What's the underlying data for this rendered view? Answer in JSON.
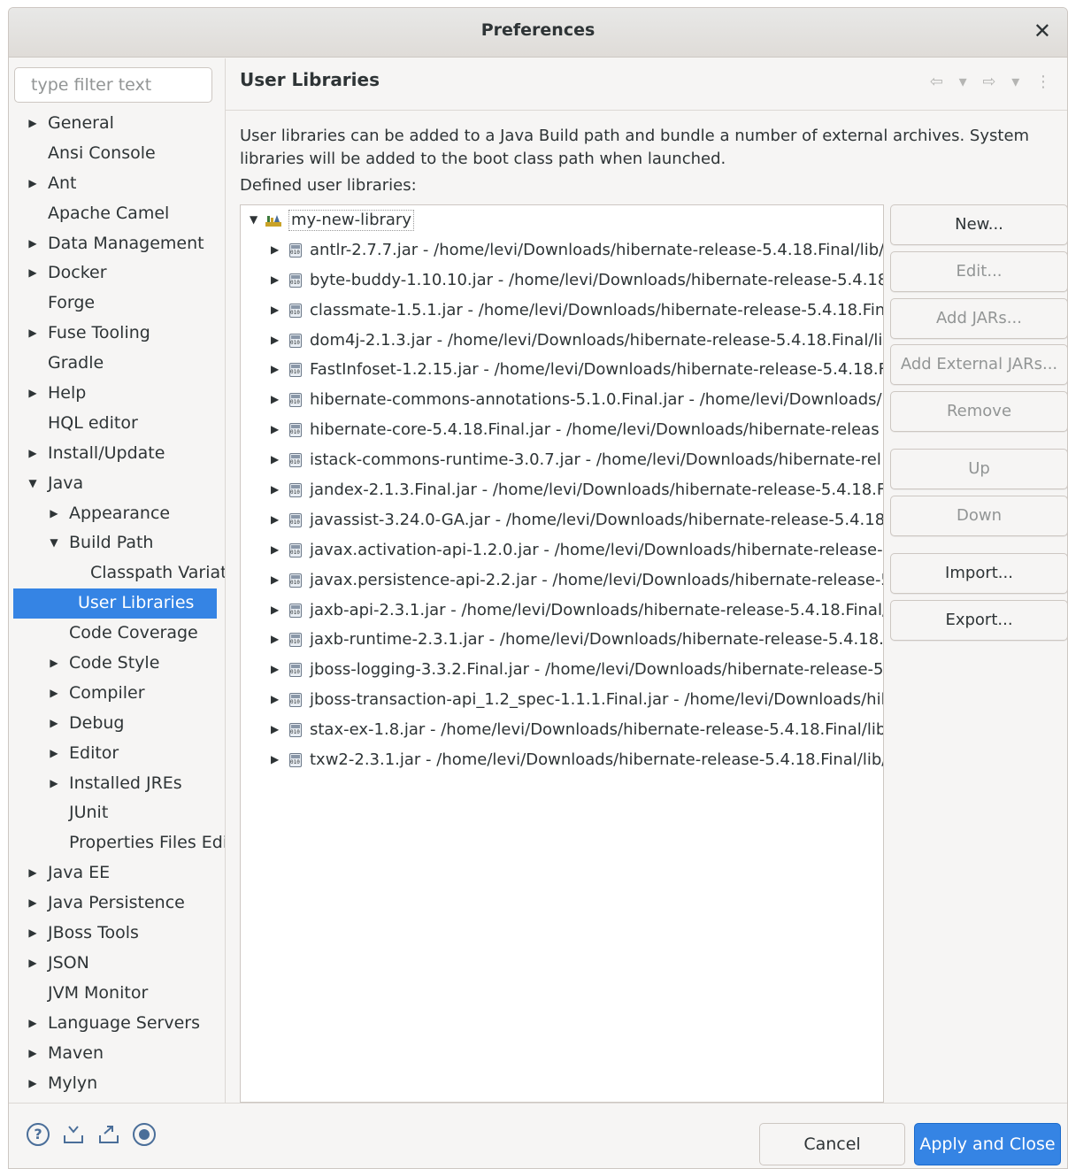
{
  "window": {
    "title": "Preferences",
    "close_glyph": "✕"
  },
  "filter": {
    "placeholder": "type filter text"
  },
  "tree": [
    {
      "label": "General",
      "level": 0,
      "expander": "closed"
    },
    {
      "label": "Ansi Console",
      "level": 0,
      "expander": "none"
    },
    {
      "label": "Ant",
      "level": 0,
      "expander": "closed"
    },
    {
      "label": "Apache Camel",
      "level": 0,
      "expander": "none"
    },
    {
      "label": "Data Management",
      "level": 0,
      "expander": "closed"
    },
    {
      "label": "Docker",
      "level": 0,
      "expander": "closed"
    },
    {
      "label": "Forge",
      "level": 0,
      "expander": "none"
    },
    {
      "label": "Fuse Tooling",
      "level": 0,
      "expander": "closed"
    },
    {
      "label": "Gradle",
      "level": 0,
      "expander": "none"
    },
    {
      "label": "Help",
      "level": 0,
      "expander": "closed"
    },
    {
      "label": "HQL editor",
      "level": 0,
      "expander": "none"
    },
    {
      "label": "Install/Update",
      "level": 0,
      "expander": "closed"
    },
    {
      "label": "Java",
      "level": 0,
      "expander": "open"
    },
    {
      "label": "Appearance",
      "level": 1,
      "expander": "closed"
    },
    {
      "label": "Build Path",
      "level": 1,
      "expander": "open"
    },
    {
      "label": "Classpath Variat",
      "level": 2,
      "expander": "none"
    },
    {
      "label": "User Libraries",
      "level": 2,
      "expander": "none",
      "selected": true
    },
    {
      "label": "Code Coverage",
      "level": 1,
      "expander": "none"
    },
    {
      "label": "Code Style",
      "level": 1,
      "expander": "closed"
    },
    {
      "label": "Compiler",
      "level": 1,
      "expander": "closed"
    },
    {
      "label": "Debug",
      "level": 1,
      "expander": "closed"
    },
    {
      "label": "Editor",
      "level": 1,
      "expander": "closed"
    },
    {
      "label": "Installed JREs",
      "level": 1,
      "expander": "closed"
    },
    {
      "label": "JUnit",
      "level": 1,
      "expander": "none"
    },
    {
      "label": "Properties Files Edi",
      "level": 1,
      "expander": "none"
    },
    {
      "label": "Java EE",
      "level": 0,
      "expander": "closed"
    },
    {
      "label": "Java Persistence",
      "level": 0,
      "expander": "closed"
    },
    {
      "label": "JBoss Tools",
      "level": 0,
      "expander": "closed"
    },
    {
      "label": "JSON",
      "level": 0,
      "expander": "closed"
    },
    {
      "label": "JVM Monitor",
      "level": 0,
      "expander": "none"
    },
    {
      "label": "Language Servers",
      "level": 0,
      "expander": "closed"
    },
    {
      "label": "Maven",
      "level": 0,
      "expander": "closed"
    },
    {
      "label": "Mylyn",
      "level": 0,
      "expander": "closed"
    }
  ],
  "page": {
    "title": "User Libraries",
    "nav_icons": "⇦ ▾ ⇨ ▾ ⋮",
    "description": "User libraries can be added to a Java Build path and bundle a number of external archives. System libraries will be added to the boot class path when launched.",
    "defined_label": "Defined user libraries:",
    "library": "my-new-library",
    "jars": [
      "antlr-2.7.7.jar - /home/levi/Downloads/hibernate-release-5.4.18.Final/lib/",
      "byte-buddy-1.10.10.jar - /home/levi/Downloads/hibernate-release-5.4.18.",
      "classmate-1.5.1.jar - /home/levi/Downloads/hibernate-release-5.4.18.Fina",
      "dom4j-2.1.3.jar - /home/levi/Downloads/hibernate-release-5.4.18.Final/li",
      "FastInfoset-1.2.15.jar - /home/levi/Downloads/hibernate-release-5.4.18.F",
      "hibernate-commons-annotations-5.1.0.Final.jar - /home/levi/Downloads/h",
      "hibernate-core-5.4.18.Final.jar - /home/levi/Downloads/hibernate-releas",
      "istack-commons-runtime-3.0.7.jar - /home/levi/Downloads/hibernate-rel",
      "jandex-2.1.3.Final.jar - /home/levi/Downloads/hibernate-release-5.4.18.F",
      "javassist-3.24.0-GA.jar - /home/levi/Downloads/hibernate-release-5.4.18",
      "javax.activation-api-1.2.0.jar - /home/levi/Downloads/hibernate-release-5",
      "javax.persistence-api-2.2.jar - /home/levi/Downloads/hibernate-release-5",
      "jaxb-api-2.3.1.jar - /home/levi/Downloads/hibernate-release-5.4.18.Final/",
      "jaxb-runtime-2.3.1.jar - /home/levi/Downloads/hibernate-release-5.4.18.F",
      "jboss-logging-3.3.2.Final.jar - /home/levi/Downloads/hibernate-release-5",
      "jboss-transaction-api_1.2_spec-1.1.1.Final.jar - /home/levi/Downloads/hib",
      "stax-ex-1.8.jar - /home/levi/Downloads/hibernate-release-5.4.18.Final/lib",
      "txw2-2.3.1.jar - /home/levi/Downloads/hibernate-release-5.4.18.Final/lib/"
    ]
  },
  "buttons": {
    "new": "New...",
    "edit": "Edit...",
    "add_jars": "Add JARs...",
    "add_external": "Add External JARs...",
    "remove": "Remove",
    "up": "Up",
    "down": "Down",
    "import": "Import...",
    "export": "Export..."
  },
  "footer": {
    "help_glyph": "?",
    "cancel": "Cancel",
    "apply": "Apply and Close"
  },
  "colors": {
    "accent": "#3584e4",
    "background": "#f6f5f4"
  }
}
